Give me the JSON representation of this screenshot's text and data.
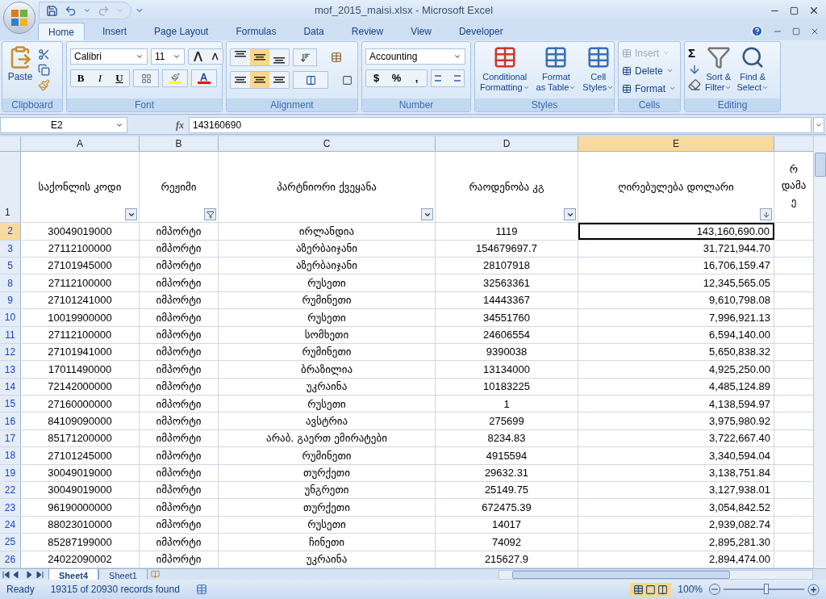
{
  "window": {
    "title": "mof_2015_maisi.xlsx - Microsoft Excel"
  },
  "tabs": [
    {
      "label": "Home",
      "selected": true
    },
    {
      "label": "Insert",
      "selected": false
    },
    {
      "label": "Page Layout",
      "selected": false
    },
    {
      "label": "Formulas",
      "selected": false
    },
    {
      "label": "Data",
      "selected": false
    },
    {
      "label": "Review",
      "selected": false
    },
    {
      "label": "View",
      "selected": false
    },
    {
      "label": "Developer",
      "selected": false
    }
  ],
  "ribbon": {
    "clipboard": {
      "title": "Clipboard",
      "paste": "Paste"
    },
    "font": {
      "title": "Font",
      "name": "Calibri",
      "size": "11",
      "styles": [
        "B",
        "I",
        "U"
      ]
    },
    "alignment": {
      "title": "Alignment",
      "vertical_buttons": [
        {
          "selected": false
        },
        {
          "selected": true
        },
        {
          "selected": false
        }
      ],
      "horizontal_buttons": [
        {
          "selected": false
        },
        {
          "selected": true
        },
        {
          "selected": false
        }
      ]
    },
    "number": {
      "title": "Number",
      "format": "Accounting",
      "buttons": [
        "$",
        "%",
        ","
      ]
    },
    "styles": {
      "title": "Styles",
      "buttons": [
        {
          "line1": "Conditional",
          "line2": "Formatting"
        },
        {
          "line1": "Format",
          "line2": "as Table"
        },
        {
          "line1": "Cell",
          "line2": "Styles"
        }
      ]
    },
    "cells": {
      "title": "Cells",
      "buttons": [
        {
          "label": "Insert",
          "disabled": true
        },
        {
          "label": "Delete",
          "disabled": false
        },
        {
          "label": "Format",
          "disabled": false
        }
      ]
    },
    "editing": {
      "title": "Editing",
      "sigma": "Σ",
      "buttons": [
        {
          "line1": "Sort &",
          "line2": "Filter"
        },
        {
          "line1": "Find &",
          "line2": "Select"
        }
      ]
    }
  },
  "formula_bar": {
    "name_box": "E2",
    "fx": "fx",
    "formula": "143160690"
  },
  "sheet": {
    "columns": [
      {
        "letter": "A",
        "header": "საქონლის კოდი",
        "kind": "dropdown",
        "selected": false
      },
      {
        "letter": "B",
        "header": "რეჟიმი",
        "kind": "filtered",
        "selected": false
      },
      {
        "letter": "C",
        "header": "პარტნიორი ქვეყანა",
        "kind": "dropdown",
        "selected": false
      },
      {
        "letter": "D",
        "header": "რაოდენობა კგ",
        "kind": "dropdown",
        "selected": false
      },
      {
        "letter": "E",
        "header": "ღირებულება დოლარი",
        "kind": "sorted",
        "selected": true
      }
    ],
    "column_6_header_lines": [
      "რ",
      "დამა",
      "ე"
    ],
    "header_row_number": "1",
    "rows": [
      {
        "number": "2",
        "selected": true,
        "cells": [
          "30049019000",
          "იმპორტი",
          "ირლანდია",
          "1119",
          "143,160,690.00"
        ]
      },
      {
        "number": "3",
        "selected": false,
        "cells": [
          "27112100000",
          "იმპორტი",
          "აზერბაიჯანი",
          "154679697.7",
          "31,721,944.70"
        ]
      },
      {
        "number": "5",
        "selected": false,
        "cells": [
          "27101945000",
          "იმპორტი",
          "აზერბაიჯანი",
          "28107918",
          "16,706,159.47"
        ]
      },
      {
        "number": "8",
        "selected": false,
        "cells": [
          "27112100000",
          "იმპორტი",
          "რუსეთი",
          "32563361",
          "12,345,565.05"
        ]
      },
      {
        "number": "9",
        "selected": false,
        "cells": [
          "27101241000",
          "იმპორტი",
          "რუმინეთი",
          "14443367",
          "9,610,798.08"
        ]
      },
      {
        "number": "10",
        "selected": false,
        "cells": [
          "10019900000",
          "იმპორტი",
          "რუსეთი",
          "34551760",
          "7,996,921.13"
        ]
      },
      {
        "number": "11",
        "selected": false,
        "cells": [
          "27112100000",
          "იმპორტი",
          "სომხეთი",
          "24606554",
          "6,594,140.00"
        ]
      },
      {
        "number": "12",
        "selected": false,
        "cells": [
          "27101941000",
          "იმპორტი",
          "რუმინეთი",
          "9390038",
          "5,650,838.32"
        ]
      },
      {
        "number": "13",
        "selected": false,
        "cells": [
          "17011490000",
          "იმპორტი",
          "ბრაზილია",
          "13134000",
          "4,925,250.00"
        ]
      },
      {
        "number": "14",
        "selected": false,
        "cells": [
          "72142000000",
          "იმპორტი",
          "უკრაინა",
          "10183225",
          "4,485,124.89"
        ]
      },
      {
        "number": "15",
        "selected": false,
        "cells": [
          "27160000000",
          "იმპორტი",
          "რუსეთი",
          "1",
          "4,138,594.97"
        ]
      },
      {
        "number": "16",
        "selected": false,
        "cells": [
          "84109090000",
          "იმპორტი",
          "ავსტრია",
          "275699",
          "3,975,980.92"
        ]
      },
      {
        "number": "17",
        "selected": false,
        "cells": [
          "85171200000",
          "იმპორტი",
          "არაბ. გაერთ ემირატები",
          "8234.83",
          "3,722,667.40"
        ]
      },
      {
        "number": "18",
        "selected": false,
        "cells": [
          "27101245000",
          "იმპორტი",
          "რუმინეთი",
          "4915594",
          "3,340,594.04"
        ]
      },
      {
        "number": "19",
        "selected": false,
        "cells": [
          "30049019000",
          "იმპორტი",
          "თურქეთი",
          "29632.31",
          "3,138,751.84"
        ]
      },
      {
        "number": "22",
        "selected": false,
        "cells": [
          "30049019000",
          "იმპორტი",
          "უნგრეთი",
          "25149.75",
          "3,127,938.01"
        ]
      },
      {
        "number": "23",
        "selected": false,
        "cells": [
          "96190000000",
          "იმპორტი",
          "თურქეთი",
          "672475.39",
          "3,054,842.52"
        ]
      },
      {
        "number": "24",
        "selected": false,
        "cells": [
          "88023010000",
          "იმპორტი",
          "რუსეთი",
          "14017",
          "2,939,082.74"
        ]
      },
      {
        "number": "25",
        "selected": false,
        "cells": [
          "85287199000",
          "იმპორტი",
          "ჩინეთი",
          "74092",
          "2,895,281.30"
        ]
      },
      {
        "number": "26",
        "selected": false,
        "cells": [
          "24022090002",
          "იმპორტი",
          "უკრაინა",
          "215627.9",
          "2,894,474.00"
        ]
      }
    ]
  },
  "sheet_tabs": [
    {
      "label": "Sheet4",
      "selected": true
    },
    {
      "label": "Sheet1",
      "selected": false
    }
  ],
  "status_bar": {
    "state": "Ready",
    "records": "19315 of 20930 records found",
    "zoom": "100%"
  }
}
